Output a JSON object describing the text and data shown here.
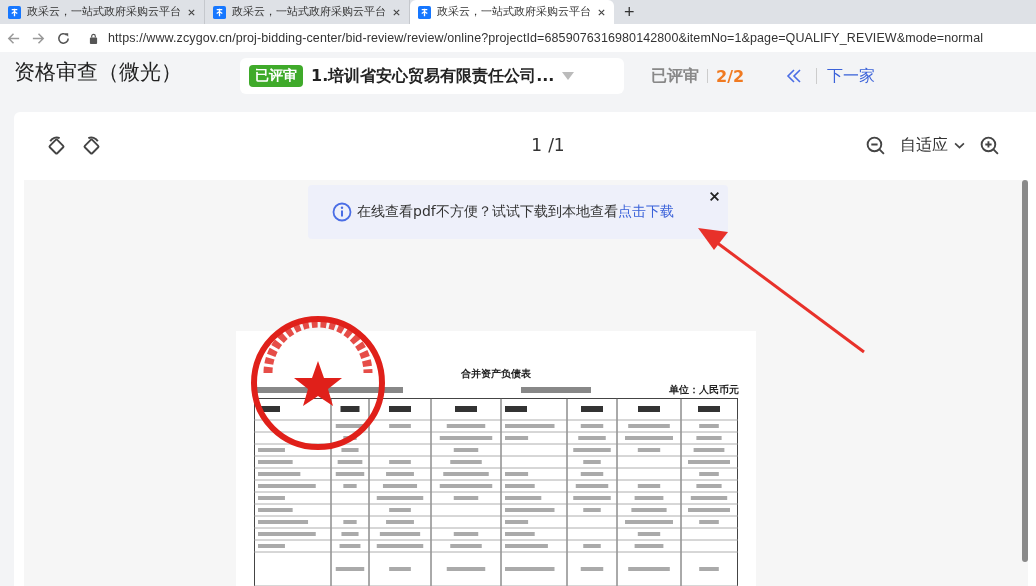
{
  "browser": {
    "tabs": [
      {
        "title": "政采云，一站式政府采购云平台",
        "selected": false
      },
      {
        "title": "政采云，一站式政府采购云平台",
        "selected": false
      },
      {
        "title": "政采云，一站式政府采购云平台",
        "selected": true
      }
    ],
    "new_tab": "+",
    "url": "https://www.zcygov.cn/proj-bidding-center/bid-review/review/online?projectId=6859076316980142800&itemNo=1&page=QUALIFY_REVIEW&mode=normal"
  },
  "header": {
    "title": "资格审查（微光）",
    "supplier": {
      "badge": "已评审",
      "name": "1.培训省安心贸易有限责任公司..."
    },
    "status": "已评审",
    "progress": "2/2",
    "next": "下一家"
  },
  "viewer": {
    "page": "1",
    "page_total": "/1",
    "zoom": "自适应",
    "notice": {
      "text": "在线查看pdf不方便？试试下载到本地查看",
      "link": "点击下载"
    }
  },
  "document": {
    "title": "合并资产负债表",
    "unit": "单位：人民币元"
  }
}
